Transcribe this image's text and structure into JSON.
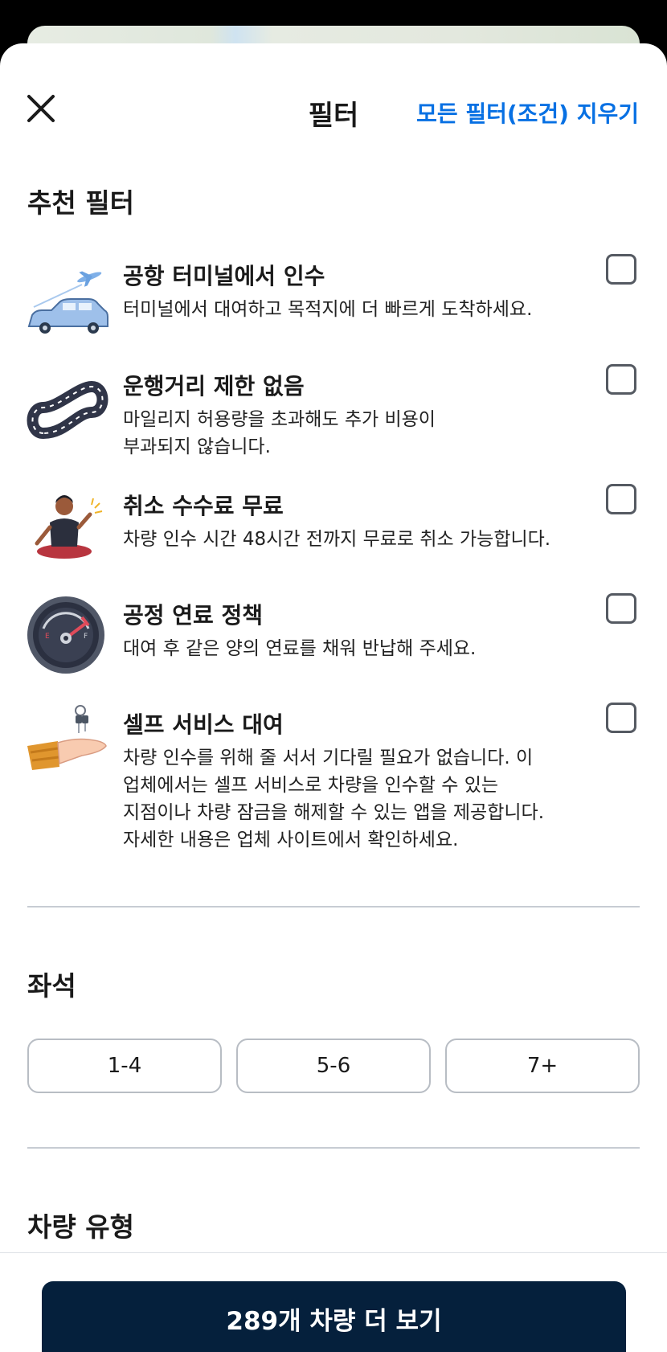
{
  "header": {
    "title": "필터",
    "clear_label": "모든 필터(조건) 지우기"
  },
  "recommended": {
    "title": "추천 필터",
    "items": [
      {
        "icon": "airport-car-icon",
        "title": "공항 터미널에서 인수",
        "desc": "터미널에서 대여하고 목적지에 더 빠르게 도착하세요.",
        "checked": false
      },
      {
        "icon": "infinity-road-icon",
        "title": "운행거리 제한 없음",
        "desc_lines": [
          "마일리지 허용량을 초과해도 추가 비용이",
          "부과되지 않습니다."
        ],
        "checked": false
      },
      {
        "icon": "relaxed-person-icon",
        "title": "취소 수수료 무료",
        "desc": "차량 인수 시간 48시간 전까지 무료로 취소 가능합니다.",
        "checked": false
      },
      {
        "icon": "fuel-gauge-icon",
        "title": "공정 연료 정책",
        "desc": "대여 후 같은 양의 연료를 채워 반납해 주세요.",
        "checked": false
      },
      {
        "icon": "hand-keys-icon",
        "title": "셀프 서비스 대여",
        "desc_lines": [
          "차량 인수를 위해 줄 서서 기다릴 필요가 없습니다. 이",
          "업체에서는 셀프 서비스로 차량을 인수할 수 있는",
          "지점이나 차량 잠금을 해제할 수 있는 앱을 제공합니다.",
          "자세한 내용은 업체 사이트에서 확인하세요."
        ],
        "checked": false
      }
    ]
  },
  "seats": {
    "title": "좌석",
    "options": [
      "1-4",
      "5-6",
      "7+"
    ]
  },
  "vehicle_type": {
    "title": "차량 유형"
  },
  "cta": {
    "label": "289개 차량 더 보기"
  },
  "colors": {
    "accent": "#0770e3",
    "cta_bg": "#05203c"
  }
}
